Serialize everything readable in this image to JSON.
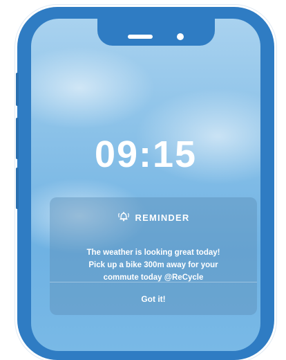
{
  "device": {
    "frame_color": "#2F7CC3",
    "screen_accent": "#8AC1E8"
  },
  "lockscreen": {
    "time": "09:15"
  },
  "notification": {
    "icon": "bell-icon",
    "title": "REMINDER",
    "message": "The weather is looking great today!\nPick up a bike 300m away  for your\ncommute today @ReCycle",
    "action_label": "Got it!"
  }
}
